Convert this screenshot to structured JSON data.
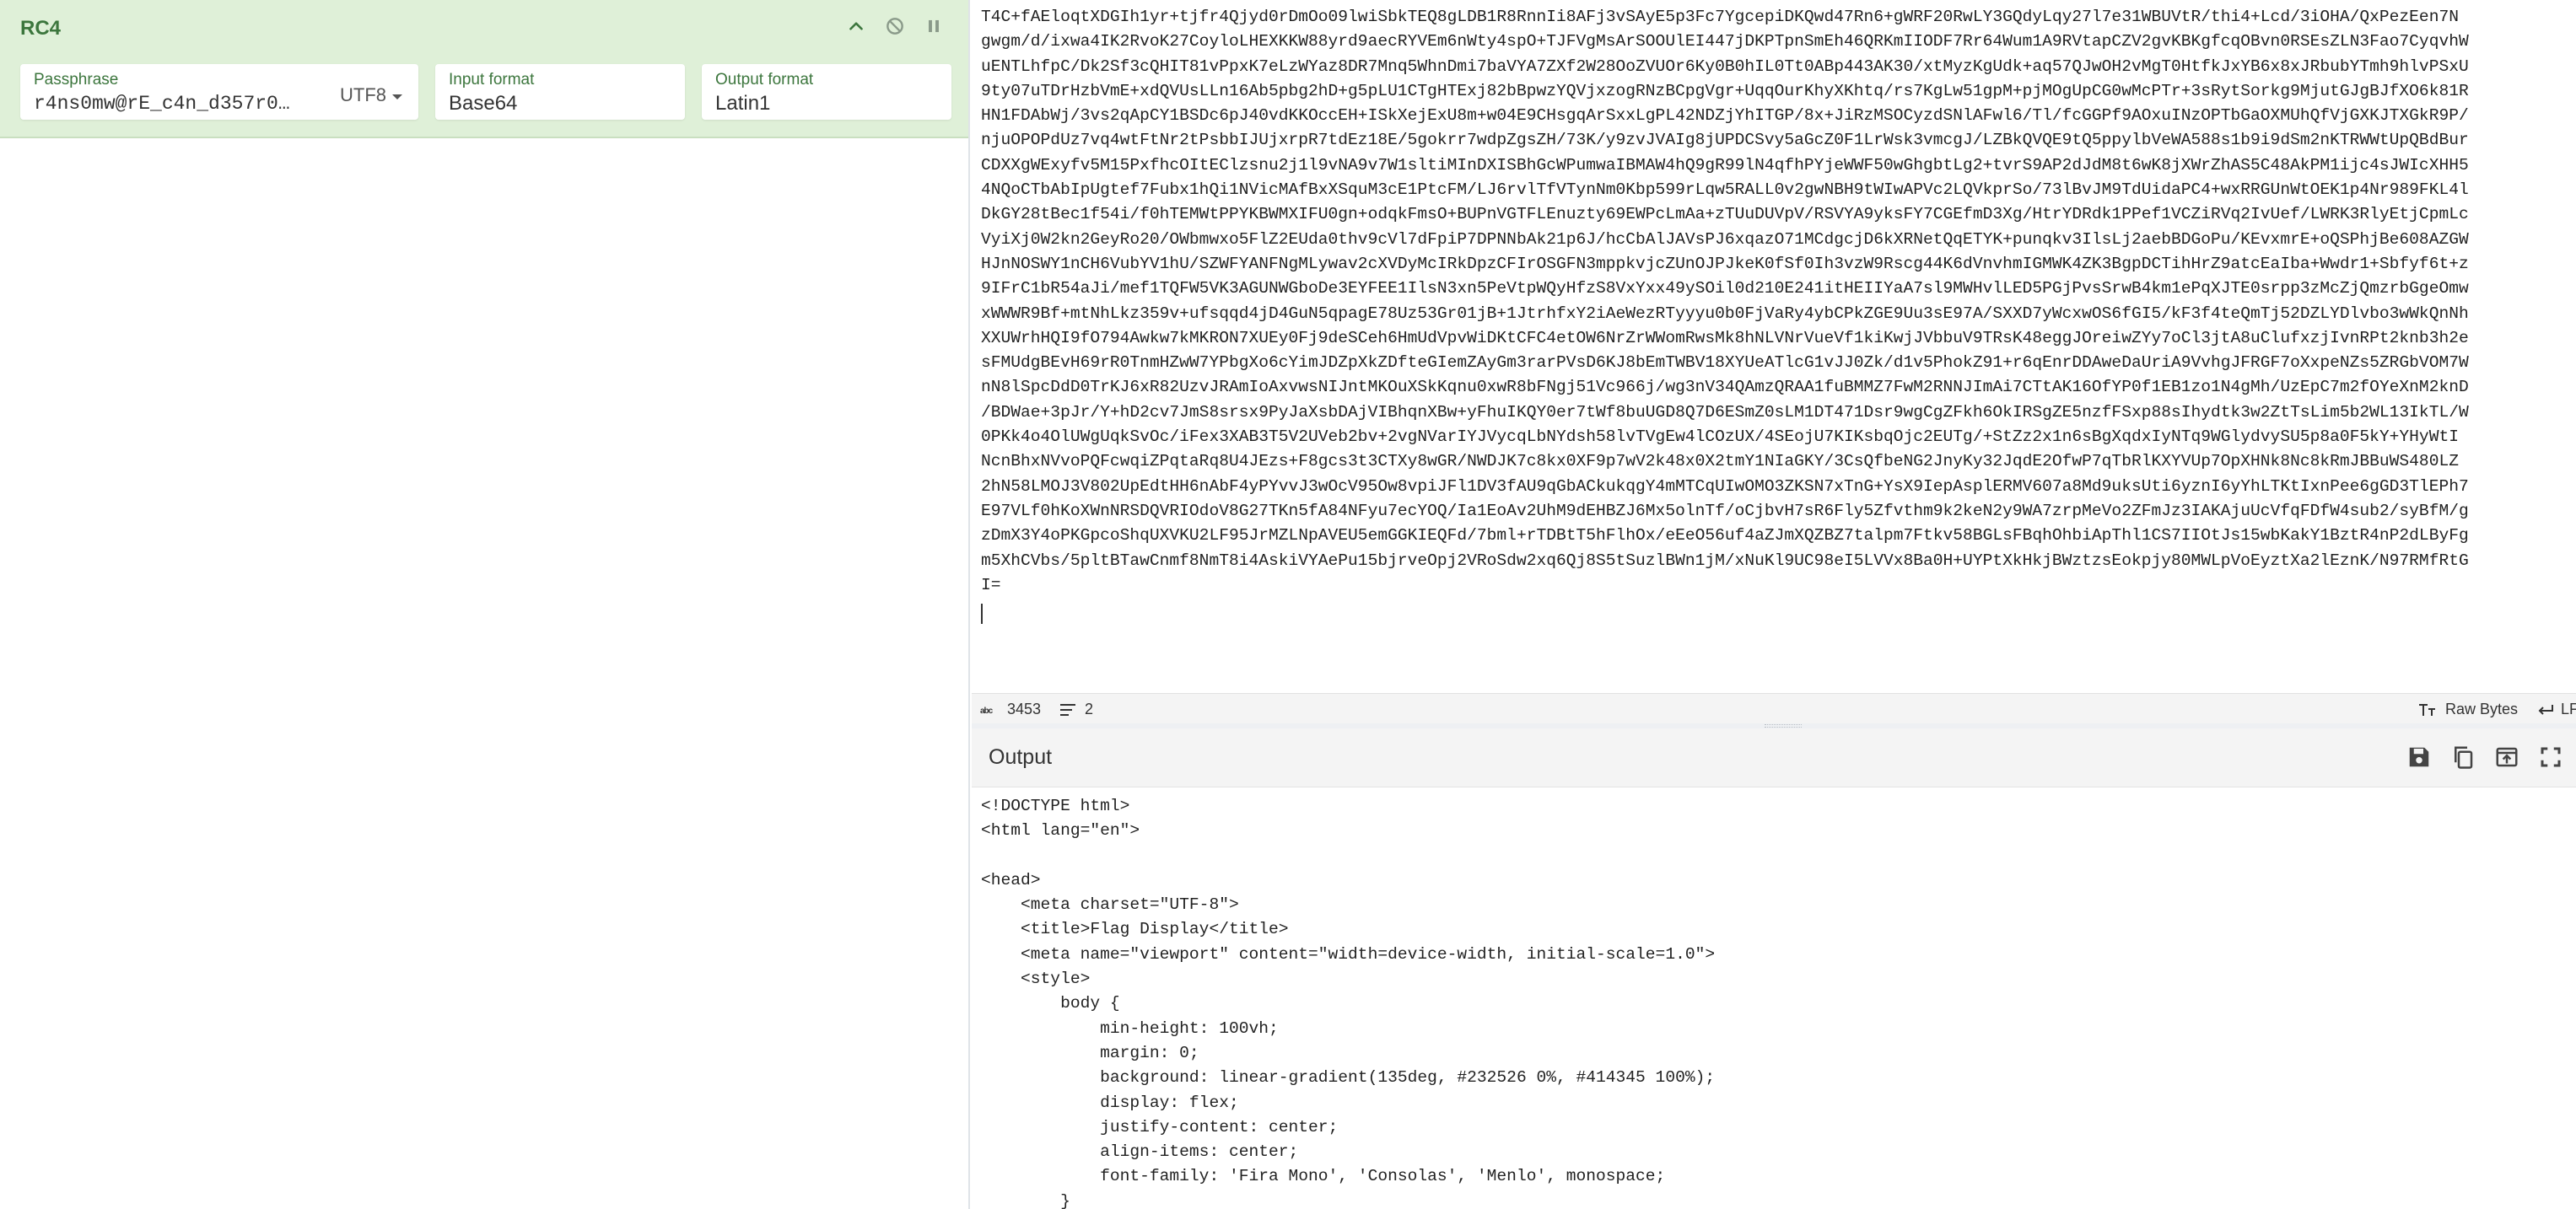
{
  "recipe": {
    "operation": {
      "title": "RC4",
      "controls": [
        "chevron-up-icon",
        "disable-icon",
        "pause-icon"
      ],
      "passphrase": {
        "label": "Passphrase",
        "value": "r4ns0mw@rE_c4n_d357r0…",
        "encoding": "UTF8"
      },
      "input_format": {
        "label": "Input format",
        "value": "Base64"
      },
      "output_format": {
        "label": "Output format",
        "value": "Latin1"
      }
    }
  },
  "input": {
    "lines": [
      "T4C+fAEloqtXDGIh1yr+tjfr4Qjyd0rDmOo09lwiSbkTEQ8gLDB1R8RnnIi8AFj3vSAyE5p3Fc7YgcepiDKQwd47Rn6+gWRF20RwLY3GQdyLqy27l7e31WBUVtR/thi4+Lcd/3iOHA/QxPezEen7N",
      "gwgm/d/ixwa4IK2RvoK27CoyloLHEXKKW88yrd9aecRYVEm6nWty4spO+TJFVgMsArSOOUlEI447jDKPTpnSmEh46QRKmIIODF7Rr64Wum1A9RVtapCZV2gvKBKgfcqOBvn0RSEsZLN3Fao7CyqvhW",
      "uENTLhfpC/Dk2Sf3cQHIT81vPpxK7eLzWYaz8DR7Mnq5WhnDmi7baVYA7ZXf2W28OoZVUOr6Ky0B0hIL0Tt0ABp443AK30/xtMyzKgUdk+aq57QJwOH2vMgT0HtfkJxYB6x8xJRbubYTmh9hlvPSxU",
      "9ty07uTDrHzbVmE+xdQVUsLLn16Ab5pbg2hD+g5pLU1CTgHTExj82bBpwzYQVjxzogRNzBCpgVgr+UqqOurKhyXKhtq/rs7KgLw51gpM+pjMOgUpCG0wMcPTr+3sRytSorkg9MjutGJgBJfXO6k81R",
      "HN1FDAbWj/3vs2qApCY1BSDc6pJ40vdKKOccEH+ISkXejExU8m+w04E9CHsgqArSxxLgPL42NDZjYhITGP/8x+JiRzMSOCyzdSNlAFwl6/Tl/fcGGPf9AOxuINzOPTbGaOXMUhQfVjGXKJTXGkR9P/",
      "njuOPOPdUz7vq4wtFtNr2tPsbbIJUjxrpR7tdEz18E/5gokrr7wdpZgsZH/73K/y9zvJVAIg8jUPDCSvy5aGcZ0F1LrWsk3vmcgJ/LZBkQVQE9tQ5ppylbVeWA588s1b9i9dSm2nKTRWWtUpQBdBur",
      "CDXXgWExyfv5M15PxfhcOItEClzsnu2j1l9vNA9v7W1sltiMInDXISBhGcWPumwaIBMAW4hQ9gR99lN4qfhPYjeWWF50wGhgbtLg2+tvrS9AP2dJdM8t6wK8jXWrZhAS5C48AkPM1ijc4sJWIcXHH5",
      "4NQoCTbAbIpUgtef7Fubx1hQi1NVicMAfBxXSquM3cE1PtcFM/LJ6rvlTfVTynNm0Kbp599rLqw5RALL0v2gwNBH9tWIwAPVc2LQVkprSo/73lBvJM9TdUidaPC4+wxRRGUnWtOEK1p4Nr989FKL4l",
      "DkGY28tBec1f54i/f0hTEMWtPPYKBWMXIFU0gn+odqkFmsO+BUPnVGTFLEnuzty69EWPcLmAa+zTUuDUVpV/RSVYA9yksFY7CGEfmD3Xg/HtrYDRdk1PPef1VCZiRVq2IvUef/LWRK3RlyEtjCpmLc",
      "VyiXj0W2kn2GeyRo20/OWbmwxo5FlZ2EUda0thv9cVl7dFpiP7DPNNbAk21p6J/hcCbAlJAVsPJ6xqazO71MCdgcjD6kXRNetQqETYK+punqkv3IlsLj2aebBDGoPu/KEvxmrE+oQSPhjBe608AZGW",
      "HJnNOSWY1nCH6VubYV1hU/SZWFYANFNgMLywav2cXVDyMcIRkDpzCFIrOSGFN3mppkvjcZUnOJPJkeK0fSf0Ih3vzW9Rscg44K6dVnvhmIGMWK4ZK3BgpDCTihHrZ9atcEaIba+Wwdr1+Sbfyf6t+z",
      "9IFrC1bR54aJi/mef1TQFW5VK3AGUNWGboDe3EYFEE1IlsN3xn5PeVtpWQyHfzS8VxYxx49ySOil0d210E241itHEIIYaA7sl9MWHvlLED5PGjPvsSrwB4km1ePqXJTE0srpp3zMcZjQmzrbGgeOmw",
      "xWWWR9Bf+mtNhLkz359v+ufsqqd4jD4GuN5qpagE78Uz53Gr01jB+1JtrhfxY2iAeWezRTyyyu0b0FjVaRy4ybCPkZGE9Uu3sE97A/SXXD7yWcxwOS6fGI5/kF3f4teQmTj52DZLYDlvbo3wWkQnNh",
      "XXUWrhHQI9fO794Awkw7kMKRON7XUEy0Fj9deSCeh6HmUdVpvWiDKtCFC4etOW6NrZrWWomRwsMk8hNLVNrVueVf1kiKwjJVbbuV9TRsK48eggJOreiwZYy7oCl3jtA8uClufxzjIvnRPt2knb3h2e",
      "sFMUdgBEvH69rR0TnmHZwW7YPbgXo6cYimJDZpXkZDfteGIemZAyGm3rarPVsD6KJ8bEmTWBV18XYUeATlcG1vJJ0Zk/d1v5PhokZ91+r6qEnrDDAweDaUriA9VvhgJFRGF7oXxpeNZs5ZRGbVOM7W",
      "nN8lSpcDdD0TrKJ6xR82UzvJRAmIoAxvwsNIJntMKOuXSkKqnu0xwR8bFNgj51Vc966j/wg3nV34QAmzQRAA1fuBMMZ7FwM2RNNJImAi7CTtAK16OfYP0f1EB1zo1N4gMh/UzEpC7m2fOYeXnM2knD",
      "/BDWae+3pJr/Y+hD2cv7JmS8srsx9PyJaXsbDAjVIBhqnXBw+yFhuIKQY0er7tWf8buUGD8Q7D6ESmZ0sLM1DT471Dsr9wgCgZFkh6OkIRSgZE5nzfFSxp88sIhydtk3w2ZtTsLim5b2WL13IkTL/W",
      "0PKk4o4OlUWgUqkSvOc/iFex3XAB3T5V2UVeb2bv+2vgNVarIYJVycqLbNYdsh58lvTVgEw4lCOzUX/4SEojU7KIKsbqOjc2EUTg/+StZz2x1n6sBgXqdxIyNTq9WGlydvySU5p8a0F5kY+YHyWtI",
      "NcnBhxNVvoPQFcwqiZPqtaRq8U4JEzs+F8gcs3t3CTXy8wGR/NWDJK7c8kx0XF9p7wV2k48x0X2tmY1NIaGKY/3CsQfbeNG2JnyKy32JqdE2OfwP7qTbRlKXYVUp7OpXHNk8Nc8kRmJBBuWS480LZ",
      "2hN58LMOJ3V802UpEdtHH6nAbF4yPYvvJ3wOcV95Ow8vpiJFl1DV3fAU9qGbACkukqgY4mMTCqUIwOMO3ZKSN7xTnG+YsX9IepAsplERMV607a8Md9uksUti6yznI6yYhLTKtIxnPee6gGD3TlEPh7",
      "E97VLf0hKoXWnNRSDQVRIOdoV8G27TKn5fA84NFyu7ecYOQ/Ia1EoAv2UhM9dEHBZJ6Mx5olnTf/oCjbvH7sR6Fly5Zfvthm9k2keN2y9WA7zrpMeVo2ZFmJz3IAKAjuUcVfqFDfW4sub2/syBfM/g",
      "zDmX3Y4oPKGpcoShqUXVKU2LF95JrMZLNpAVEU5emGGKIEQFd/7bml+rTDBtT5hFlhOx/eEeO56uf4aZJmXQZBZ7talpm7Ftkv58BGLsFBqhOhbiApThl1CS7IIOtJs15wbKakY1BztR4nP2dLByFg",
      "m5XhCVbs/5pltBTawCnmf8NmT8i4AskiVYAePu15bjrveOpj2VRoSdw2xq6Qj8S5tSuzlBWn1jM/xNuKl9UC98eI5LVVx8Ba0H+UYPtXkHkjBWztzsEokpjy80MWLpVoEyztXa2lEznK/N97RMfRtG",
      "I="
    ],
    "status": {
      "chars": "3453",
      "lines": "2",
      "raw_bytes_label": "Raw Bytes",
      "eol_label": "LF"
    }
  },
  "output": {
    "title": "Output",
    "actions": [
      "save-icon",
      "copy-icon",
      "replace-input-icon",
      "maximise-icon"
    ],
    "lines": [
      "<!DOCTYPE html>",
      "<html lang=\"en\">",
      "",
      "<head>",
      "    <meta charset=\"UTF-8\">",
      "    <title>Flag Display</title>",
      "    <meta name=\"viewport\" content=\"width=device-width, initial-scale=1.0\">",
      "    <style>",
      "        body {",
      "            min-height: 100vh;",
      "            margin: 0;",
      "            background: linear-gradient(135deg, #232526 0%, #414345 100%);",
      "            display: flex;",
      "            justify-content: center;",
      "            align-items: center;",
      "            font-family: 'Fira Mono', 'Consolas', 'Menlo', monospace;",
      "        }"
    ]
  },
  "colors": {
    "operation_bg": "#dff0d8",
    "operation_text": "#3c763d",
    "status_bar_bg": "#f4f4f4",
    "text": "#222222"
  }
}
